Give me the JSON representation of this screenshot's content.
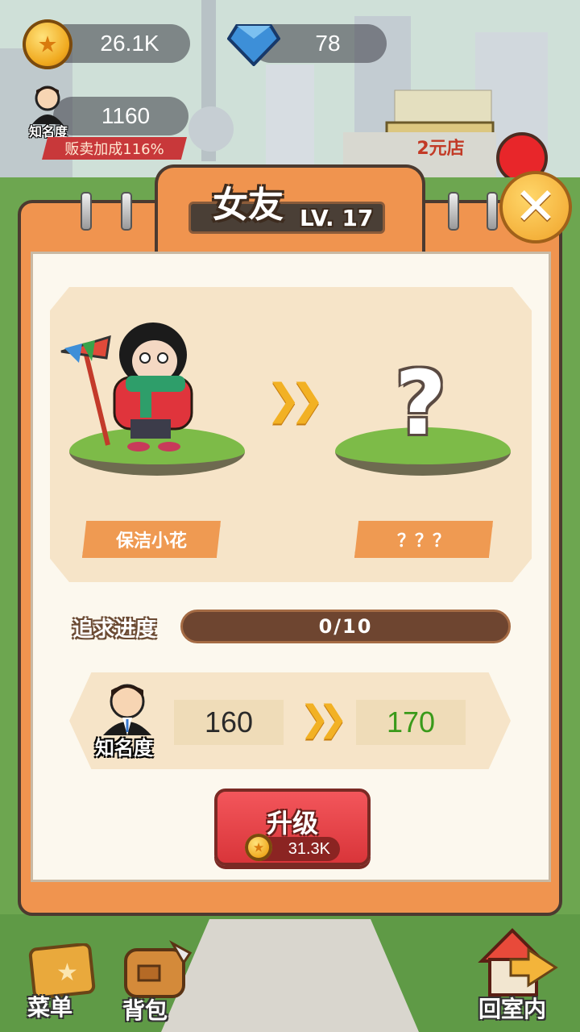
{
  "hud": {
    "coins": "26.1K",
    "diamonds": "78",
    "fame_label": "知名度",
    "fame_value": "1160",
    "sell_bonus": "贩卖加成116%"
  },
  "background": {
    "shop_sign": "2元店"
  },
  "dialog": {
    "title": "女友",
    "level": "LV. 17",
    "current_name": "保洁小花",
    "next_name": "？？？",
    "next_mystery": "?",
    "progress_label": "追求进度",
    "progress_text": "0/10",
    "progress_current": 0,
    "progress_total": 10,
    "fame_label": "知名度",
    "fame_current": "160",
    "fame_next": "170",
    "upgrade_label": "升级",
    "upgrade_cost": "31.3K",
    "close_glyph": "✕"
  },
  "nav": {
    "menu": "菜单",
    "backpack": "背包",
    "indoor": "回室内"
  },
  "colors": {
    "panel_orange": "#f0944f",
    "panel_inner": "#fcf8ee",
    "next_value_green": "#3a9a1a",
    "upgrade_red": "#e14046",
    "arrow_yellow": "#f2b124"
  }
}
